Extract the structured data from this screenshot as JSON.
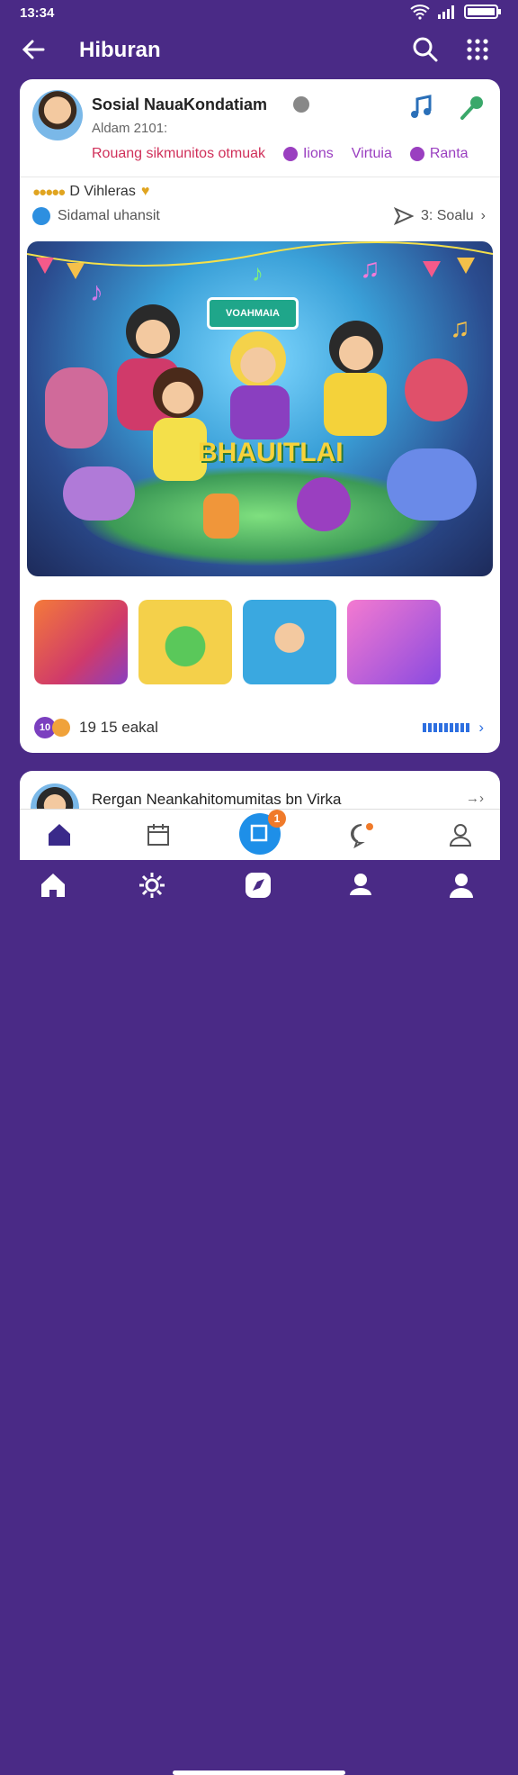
{
  "status": {
    "time": "13:34"
  },
  "appbar": {
    "title": "Hiburan"
  },
  "post": {
    "name": "Sosial NauaKondatiam",
    "subtitle": "Aldam 2101:",
    "tags": [
      {
        "label": "Rouang sikmunitos otmuak",
        "color": "#d0305a"
      },
      {
        "label": "Iions",
        "color": "#9a3fc0"
      },
      {
        "label": "Virtuia",
        "color": "#9a3fc0"
      },
      {
        "label": "Ranta",
        "color": "#9a3fc0"
      }
    ],
    "rating_text": "D Vihleras",
    "info_text": "Sidamal uhansit",
    "share_text": "3: Soalu",
    "hero_sign": "VOAHMAIA",
    "hero_word": "BHAUITLAI",
    "footer_text": "19  15 eakal",
    "footer_badge": "10"
  },
  "post2": {
    "name": "Rergan Neankahitomumitas bn Virka"
  },
  "nav": {
    "badge": "1"
  },
  "colors": {
    "primary": "#4a2a86",
    "accent": "#1e8fe8",
    "badge": "#f07a2a"
  }
}
